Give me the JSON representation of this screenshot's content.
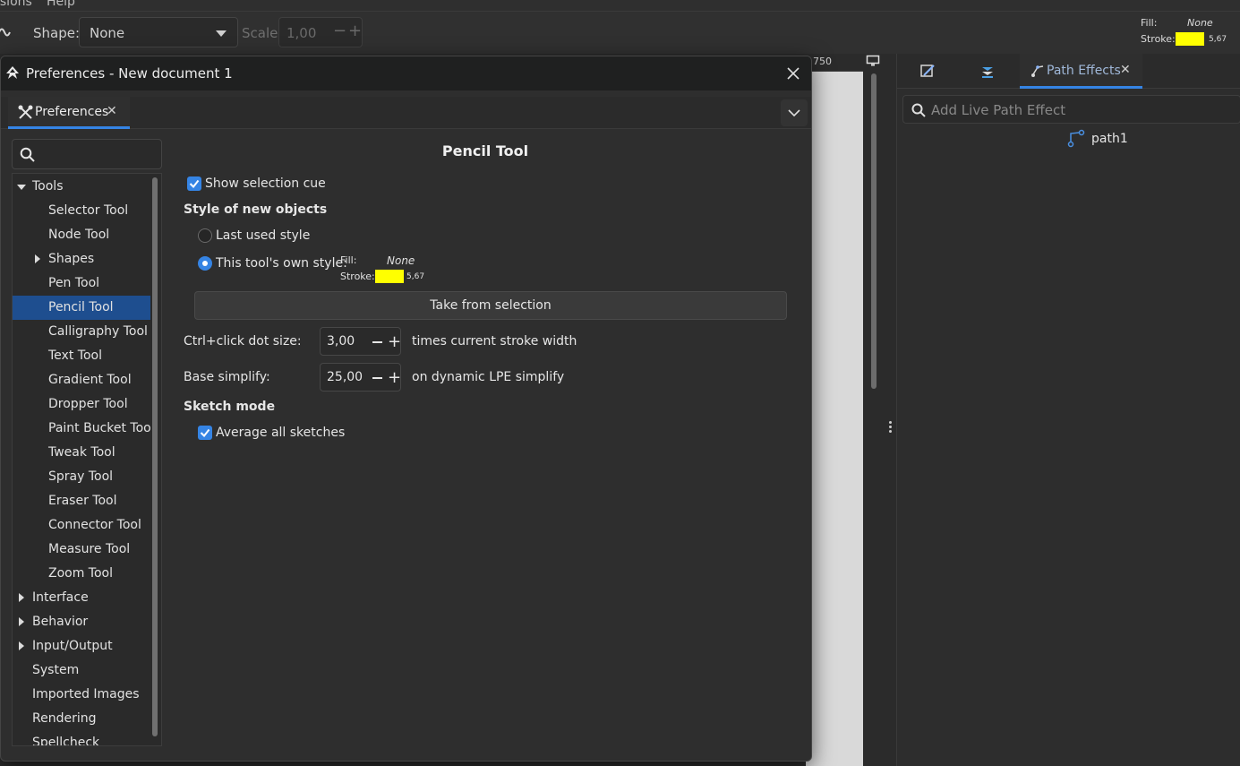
{
  "menubar": {
    "items": [
      "isions",
      "Help"
    ]
  },
  "toolbar": {
    "shape_label": "Shape:",
    "shape_value": "None",
    "scale_label": "Scale:",
    "scale_value": "1,00",
    "style": {
      "fill_label": "Fill:",
      "fill_value": "None",
      "stroke_label": "Stroke:",
      "stroke_width": "5,67",
      "stroke_color": "#ffff00"
    }
  },
  "ruler": {
    "value": "750"
  },
  "dock": {
    "tabs": [
      {
        "name": "fill-stroke-tab",
        "icon": "brush-icon"
      },
      {
        "name": "layers-tab",
        "icon": "layers-icon"
      },
      {
        "name": "path-effects-tab",
        "label": "Path Effects",
        "icon": "path-effects-icon",
        "active": true
      }
    ],
    "search_placeholder": "Add Live Path Effect",
    "path_item": "path1"
  },
  "dialog": {
    "title": "Preferences - New document 1",
    "tab_label": "Preferences",
    "tree": [
      {
        "label": "Tools",
        "level": 0,
        "expander": "down"
      },
      {
        "label": "Selector Tool",
        "level": 1
      },
      {
        "label": "Node Tool",
        "level": 1
      },
      {
        "label": "Shapes",
        "level": 1,
        "expander": "right"
      },
      {
        "label": "Pen Tool",
        "level": 1
      },
      {
        "label": "Pencil Tool",
        "level": 1,
        "selected": true
      },
      {
        "label": "Calligraphy Tool",
        "level": 1
      },
      {
        "label": "Text Tool",
        "level": 1
      },
      {
        "label": "Gradient Tool",
        "level": 1
      },
      {
        "label": "Dropper Tool",
        "level": 1
      },
      {
        "label": "Paint Bucket Tool",
        "level": 1
      },
      {
        "label": "Tweak Tool",
        "level": 1
      },
      {
        "label": "Spray Tool",
        "level": 1
      },
      {
        "label": "Eraser Tool",
        "level": 1
      },
      {
        "label": "Connector Tool",
        "level": 1
      },
      {
        "label": "Measure Tool",
        "level": 1
      },
      {
        "label": "Zoom Tool",
        "level": 1
      },
      {
        "label": "Interface",
        "level": 0,
        "expander": "right"
      },
      {
        "label": "Behavior",
        "level": 0,
        "expander": "right"
      },
      {
        "label": "Input/Output",
        "level": 0,
        "expander": "right"
      },
      {
        "label": "System",
        "level": 0
      },
      {
        "label": "Imported Images",
        "level": 0
      },
      {
        "label": "Rendering",
        "level": 0
      },
      {
        "label": "Spellcheck",
        "level": 0
      }
    ],
    "page": {
      "title": "Pencil Tool",
      "show_selection_cue": "Show selection cue",
      "style_heading": "Style of new objects",
      "last_used_style": "Last used style",
      "own_style": "This tool's own style:",
      "own_style_fill_label": "Fill:",
      "own_style_fill_value": "None",
      "own_style_stroke_label": "Stroke:",
      "own_style_stroke_width": "5,67",
      "take_from_selection": "Take from selection",
      "dot_size_label": "Ctrl+click dot size:",
      "dot_size_value": "3,00",
      "dot_size_suffix": "times current stroke width",
      "base_simplify_label": "Base simplify:",
      "base_simplify_value": "25,00",
      "base_simplify_suffix": "on dynamic LPE simplify",
      "sketch_heading": "Sketch mode",
      "average_sketches": "Average all sketches"
    }
  }
}
